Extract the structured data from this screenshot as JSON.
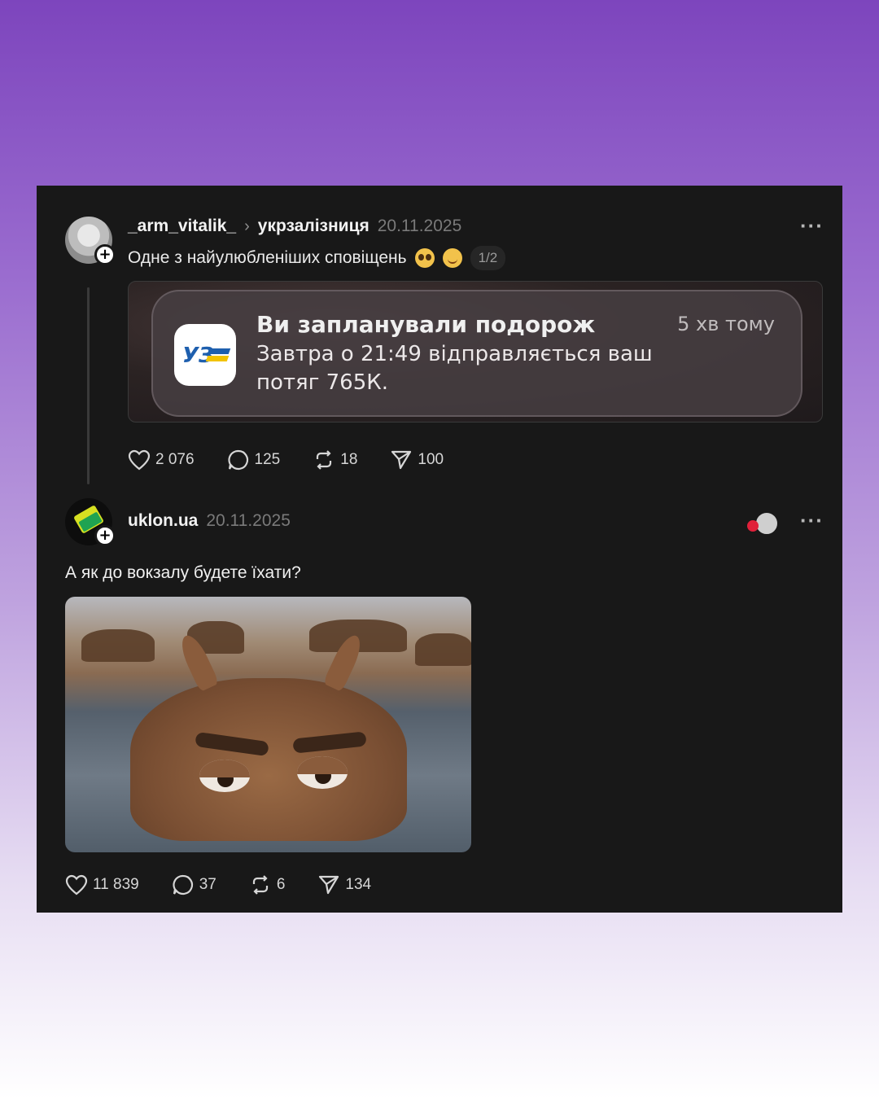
{
  "post1": {
    "username": "_arm_vitalik_",
    "separator": "›",
    "reply_to": "укрзалізниця",
    "date": "20.11.2025",
    "caption": "Одне з найулюбленіших сповіщень",
    "emojis": [
      "pleading-face",
      "smiling-face"
    ],
    "media_counter": "1/2",
    "notification": {
      "app_icon": "uz-logo",
      "title": "Ви запланували подорож",
      "time": "5 хв тому",
      "body": "Завтра о 21:49 відправляється ваш потяг 765К."
    },
    "actions": {
      "likes": "2 076",
      "comments": "125",
      "reposts": "18",
      "shares": "100"
    },
    "more": "···"
  },
  "post2": {
    "username": "uklon.ua",
    "date": "20.11.2025",
    "caption": "А як до вокзалу будете їхати?",
    "image": "hippo-in-water-gif",
    "actions": {
      "likes": "11 839",
      "comments": "37",
      "reposts": "6",
      "shares": "134"
    },
    "more": "···"
  },
  "colors": {
    "card_bg": "#181818",
    "accent_heart": "#e0203a",
    "uz_blue": "#1e5fae",
    "uz_yellow": "#f2c300"
  },
  "icons": [
    "heart-icon",
    "comment-icon",
    "repost-icon",
    "share-icon",
    "plus-icon",
    "more-icon",
    "chevron-right-icon"
  ]
}
